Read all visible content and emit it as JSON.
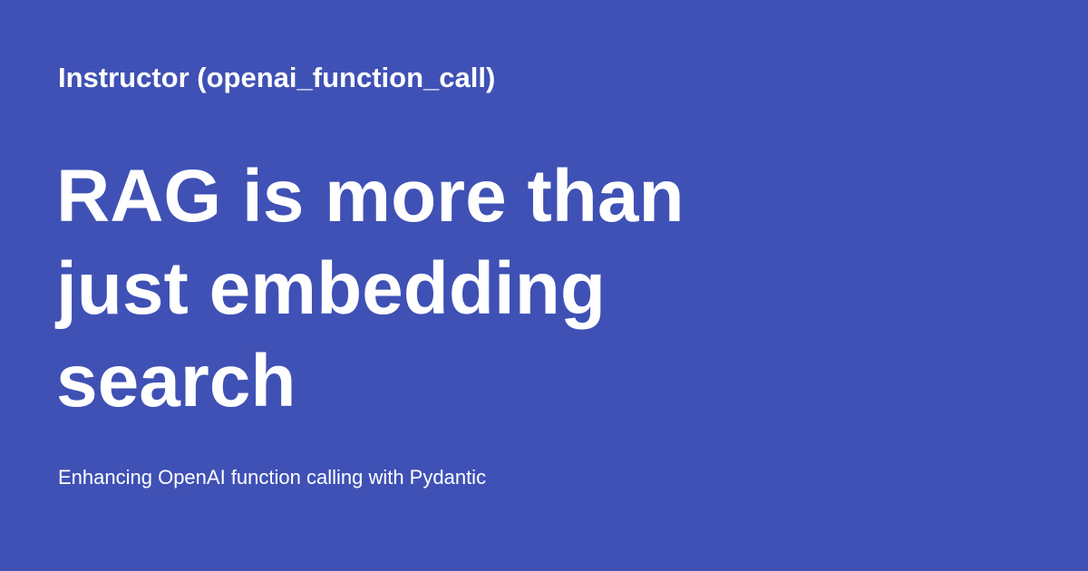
{
  "card": {
    "site_name": "Instructor (openai_function_call)",
    "title": "RAG is more than just embedding search",
    "description": "Enhancing OpenAI function calling with Pydantic",
    "colors": {
      "background": "#3f51b5",
      "text": "#ffffff"
    }
  }
}
